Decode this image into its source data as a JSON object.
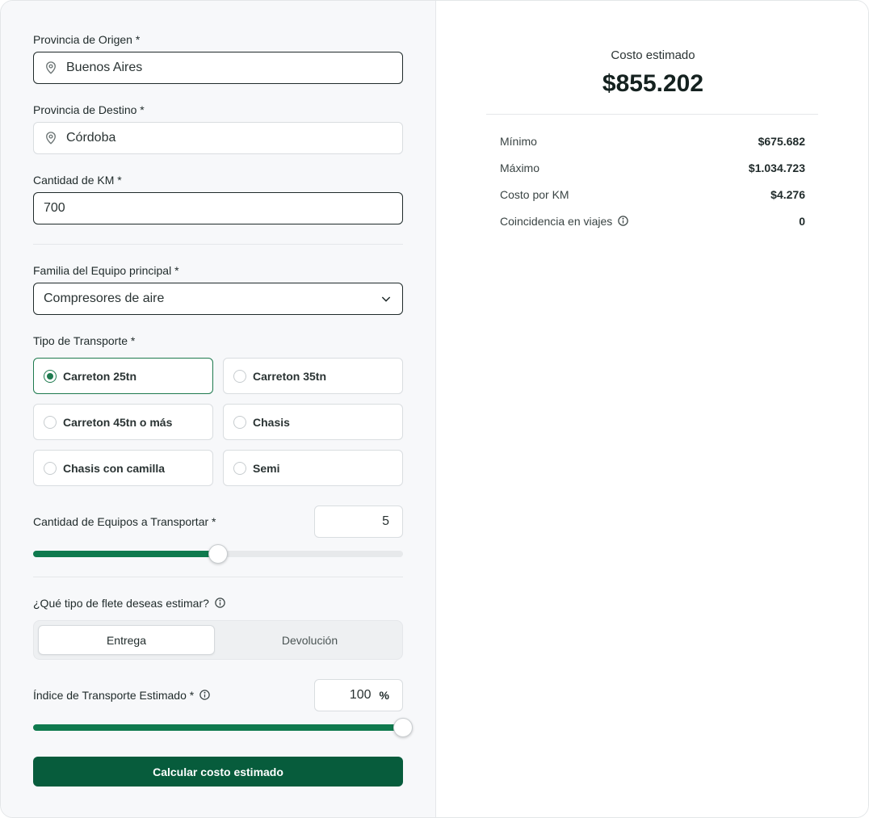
{
  "form": {
    "origin": {
      "label": "Provincia de Origen *",
      "value": "Buenos Aires"
    },
    "destination": {
      "label": "Provincia de Destino *",
      "value": "Córdoba"
    },
    "km": {
      "label": "Cantidad de KM *",
      "value": "700"
    },
    "family": {
      "label": "Familia del Equipo principal *",
      "value": "Compresores de aire"
    },
    "transport": {
      "label": "Tipo de Transporte *",
      "options": [
        "Carreton 25tn",
        "Carreton 35tn",
        "Carreton 45tn o más",
        "Chasis",
        "Chasis con camilla",
        "Semi"
      ],
      "selected": "Carreton 25tn"
    },
    "quantity": {
      "label": "Cantidad de Equipos a Transportar *",
      "value": "5",
      "slider_fraction": 0.5
    },
    "freight": {
      "label": "¿Qué tipo de flete deseas estimar?",
      "options": [
        "Entrega",
        "Devolución"
      ],
      "selected": "Entrega"
    },
    "index": {
      "label": "Índice de Transporte Estimado *",
      "value": "100",
      "unit": "%",
      "slider_fraction": 1.0
    },
    "submit_label": "Calcular costo estimado"
  },
  "result": {
    "title": "Costo estimado",
    "amount": "$855.202",
    "rows": [
      {
        "label": "Mínimo",
        "value": "$675.682"
      },
      {
        "label": "Máximo",
        "value": "$1.034.723"
      },
      {
        "label": "Costo por KM",
        "value": "$4.276"
      },
      {
        "label": "Coincidencia en viajes",
        "value": "0"
      }
    ]
  },
  "colors": {
    "accent": "#0f7a4e",
    "button": "#075c3c",
    "selected_border": "#1e7a4f"
  }
}
